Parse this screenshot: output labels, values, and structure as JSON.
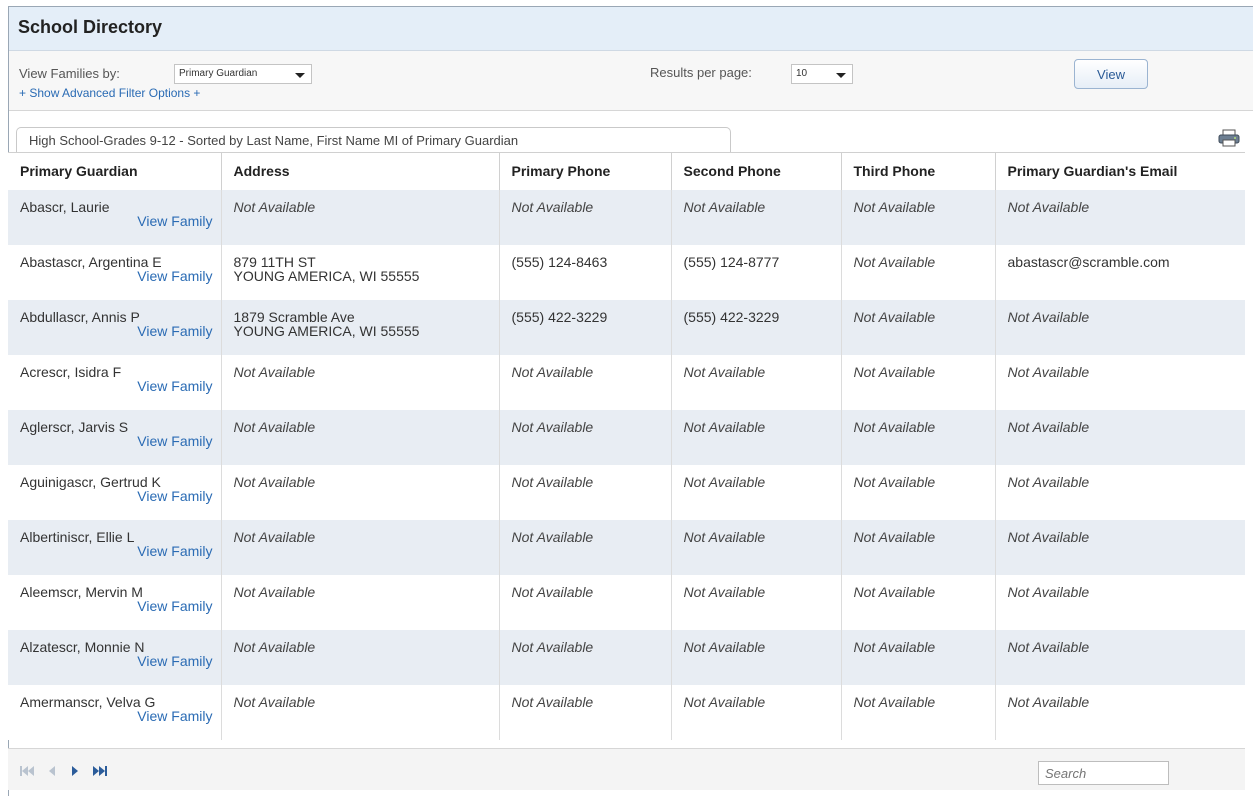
{
  "app": {
    "title": "School Directory"
  },
  "filter": {
    "view_by_label": "View Families by:",
    "view_by_value": "Primary Guardian",
    "advanced_link": "+ Show Advanced Filter Options +",
    "results_label": "Results per page:",
    "results_value": "10",
    "view_button": "View"
  },
  "tab": {
    "label": "High School-Grades 9-12 - Sorted by Last Name, First Name MI of Primary Guardian"
  },
  "icons": {
    "print": "printer-icon",
    "first": "first-page-icon",
    "prev": "prev-page-icon",
    "next": "next-page-icon",
    "last": "last-page-icon"
  },
  "colors": {
    "link": "#2a6bb4",
    "row_alt": "#e8edf3",
    "header_bg": "#e4eef8"
  },
  "table": {
    "columns": [
      "Primary Guardian",
      "Address",
      "Primary Phone",
      "Second Phone",
      "Third Phone",
      "Primary Guardian's Email"
    ],
    "view_family_label": "View Family",
    "rows": [
      {
        "name": "Abascr, Laurie",
        "address1": "Not Available",
        "address2": "",
        "phone1": "Not Available",
        "phone2": "Not Available",
        "phone3": "Not Available",
        "email": "Not Available"
      },
      {
        "name": "Abastascr, Argentina E",
        "address1": "879 11TH ST",
        "address2": "YOUNG AMERICA, WI 55555",
        "phone1": "(555) 124-8463",
        "phone2": "(555) 124-8777",
        "phone3": "Not Available",
        "email": "abastascr@scramble.com"
      },
      {
        "name": "Abdullascr, Annis P",
        "address1": "1879 Scramble Ave",
        "address2": "YOUNG AMERICA, WI 55555",
        "phone1": "(555) 422-3229",
        "phone2": "(555) 422-3229",
        "phone3": "Not Available",
        "email": "Not Available"
      },
      {
        "name": "Acrescr, Isidra F",
        "address1": "Not Available",
        "address2": "",
        "phone1": "Not Available",
        "phone2": "Not Available",
        "phone3": "Not Available",
        "email": "Not Available"
      },
      {
        "name": "Aglerscr, Jarvis S",
        "address1": "Not Available",
        "address2": "",
        "phone1": "Not Available",
        "phone2": "Not Available",
        "phone3": "Not Available",
        "email": "Not Available"
      },
      {
        "name": "Aguinigascr, Gertrud K",
        "address1": "Not Available",
        "address2": "",
        "phone1": "Not Available",
        "phone2": "Not Available",
        "phone3": "Not Available",
        "email": "Not Available"
      },
      {
        "name": "Albertiniscr, Ellie L",
        "address1": "Not Available",
        "address2": "",
        "phone1": "Not Available",
        "phone2": "Not Available",
        "phone3": "Not Available",
        "email": "Not Available"
      },
      {
        "name": "Aleemscr, Mervin M",
        "address1": "Not Available",
        "address2": "",
        "phone1": "Not Available",
        "phone2": "Not Available",
        "phone3": "Not Available",
        "email": "Not Available"
      },
      {
        "name": "Alzatescr, Monnie N",
        "address1": "Not Available",
        "address2": "",
        "phone1": "Not Available",
        "phone2": "Not Available",
        "phone3": "Not Available",
        "email": "Not Available"
      },
      {
        "name": "Amermanscr, Velva G",
        "address1": "Not Available",
        "address2": "",
        "phone1": "Not Available",
        "phone2": "Not Available",
        "phone3": "Not Available",
        "email": "Not Available"
      }
    ]
  },
  "footer": {
    "search_placeholder": "Search"
  }
}
